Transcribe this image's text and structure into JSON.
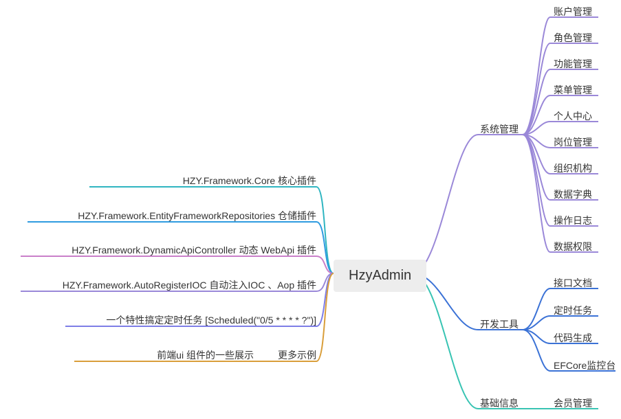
{
  "center": "HzyAdmin",
  "left": {
    "items": [
      "HZY.Framework.Core 核心插件",
      "HZY.Framework.EntityFrameworkRepositories 仓储插件",
      "HZY.Framework.DynamicApiController 动态 WebApi 插件",
      "HZY.Framework.AutoRegisterIOC 自动注入IOC 、Aop 插件",
      "一个特性搞定定时任务 [Scheduled(\"0/5 * * * * ?\")]"
    ],
    "last": {
      "text1": "前端ui 组件的一些展示",
      "text2": "更多示例"
    }
  },
  "right": {
    "branches": [
      {
        "label": "系统管理",
        "children": [
          "账户管理",
          "角色管理",
          "功能管理",
          "菜单管理",
          "个人中心",
          "岗位管理",
          "组织机构",
          "数据字典",
          "操作日志",
          "数据权限"
        ]
      },
      {
        "label": "开发工具",
        "children": [
          "接口文档",
          "定时任务",
          "代码生成",
          "EFCore监控台"
        ]
      },
      {
        "label": "基础信息",
        "children": [
          "会员管理"
        ]
      }
    ]
  },
  "colors": {
    "left": [
      "#2fb5c1",
      "#2e9be0",
      "#c97fc9",
      "#9a88d8",
      "#7d7de6",
      "#d99e3a"
    ],
    "rightBranch": [
      "#9a88d8",
      "#3b72d6",
      "#38c4b3"
    ],
    "leaf": "#555"
  }
}
